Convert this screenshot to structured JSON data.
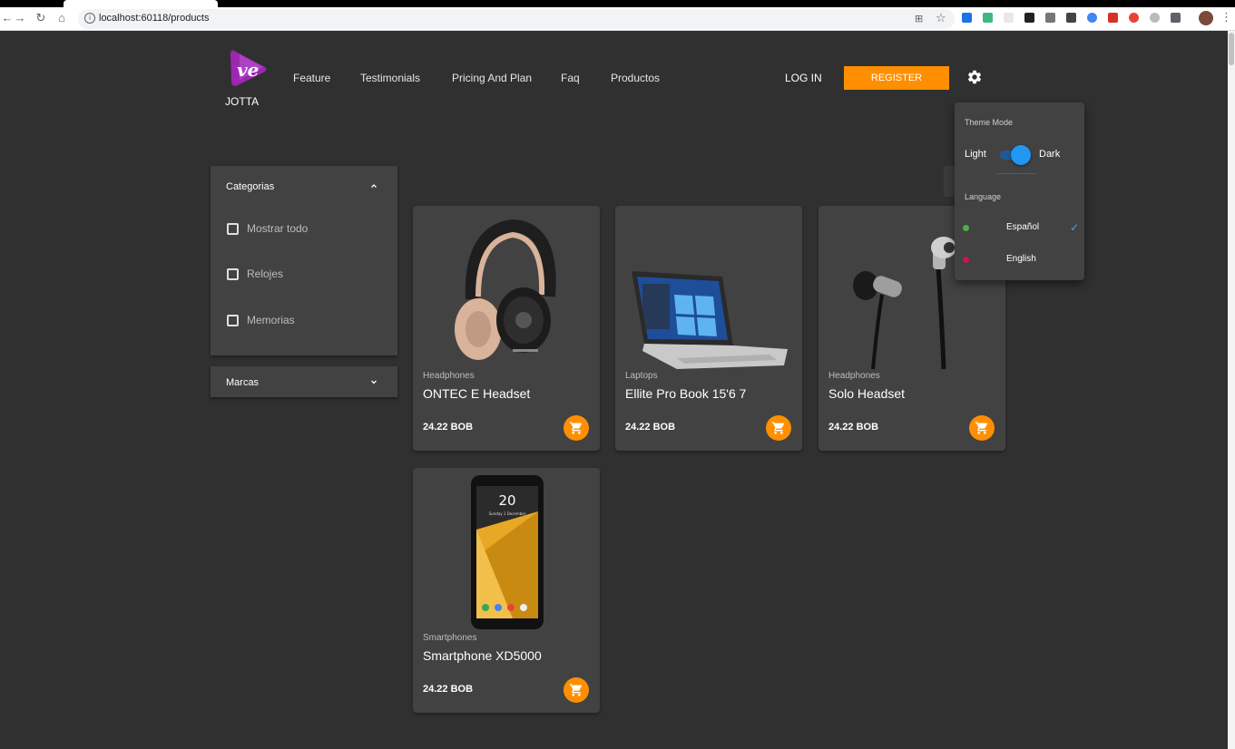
{
  "browser": {
    "url": "localhost:60118/products"
  },
  "header": {
    "logo_text": "JOTTA",
    "nav": [
      "Feature",
      "Testimonials",
      "Pricing And Plan",
      "Faq",
      "Productos"
    ],
    "login_label": "LOG IN",
    "register_label": "REGISTER"
  },
  "sidebar": {
    "categories_title": "Categorias",
    "categories": [
      "Mostrar todo",
      "Relojes",
      "Memorias"
    ],
    "brands_title": "Marcas"
  },
  "products": [
    {
      "category": "Headphones",
      "name": "ONTEC E Headset",
      "price": "24.22 BOB"
    },
    {
      "category": "Laptops",
      "name": "Ellite Pro Book 15'6 7",
      "price": "24.22 BOB"
    },
    {
      "category": "Headphones",
      "name": "Solo Headset",
      "price": "24.22 BOB"
    },
    {
      "category": "Smartphones",
      "name": "Smartphone XD5000",
      "price": "24.22 BOB"
    }
  ],
  "phone_screen": {
    "time": "20",
    "date": "Sunday 1 December"
  },
  "settings": {
    "theme_title": "Theme Mode",
    "light_label": "Light",
    "dark_label": "Dark",
    "theme_dark_on": true,
    "language_title": "Language",
    "languages": [
      {
        "name": "Español",
        "selected": true
      },
      {
        "name": "English",
        "selected": false
      }
    ]
  },
  "colors": {
    "background": "#303030",
    "surface": "#424242",
    "accent": "#ff8f00",
    "toggle": "#2196f3"
  }
}
